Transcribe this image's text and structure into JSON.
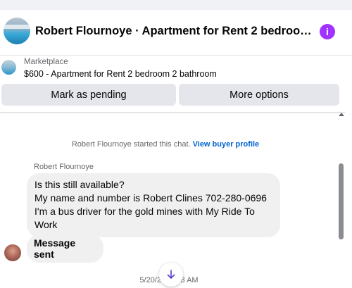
{
  "header": {
    "title": "Robert Flournoye · Apartment for Rent 2 bedroom 2 b…",
    "info_icon": "i"
  },
  "listing": {
    "label": "Marketplace",
    "title": "$600 - Apartment for Rent 2 bedroom 2 bathroom",
    "mark_pending_label": "Mark as pending",
    "more_options_label": "More options"
  },
  "chat": {
    "system_text": "Robert Flournoye started this chat.",
    "view_profile_label": "View buyer profile",
    "sender_name": "Robert Flournoye",
    "message_lines": [
      "Is this still available?",
      "My name and number is Robert Clines 702-280-0696",
      "I'm a bus driver for the gold mines with My Ride To",
      "Work"
    ],
    "message2": "Message sent",
    "timestamp": "5/20/25, 6:48 AM"
  },
  "colors": {
    "accent_purple": "#a033ff",
    "link_blue": "#0064d1",
    "bubble_gray": "#f0f0f0",
    "button_gray": "#e4e6eb"
  },
  "icons": {
    "info": "info-icon",
    "jump": "arrow-down-icon"
  }
}
